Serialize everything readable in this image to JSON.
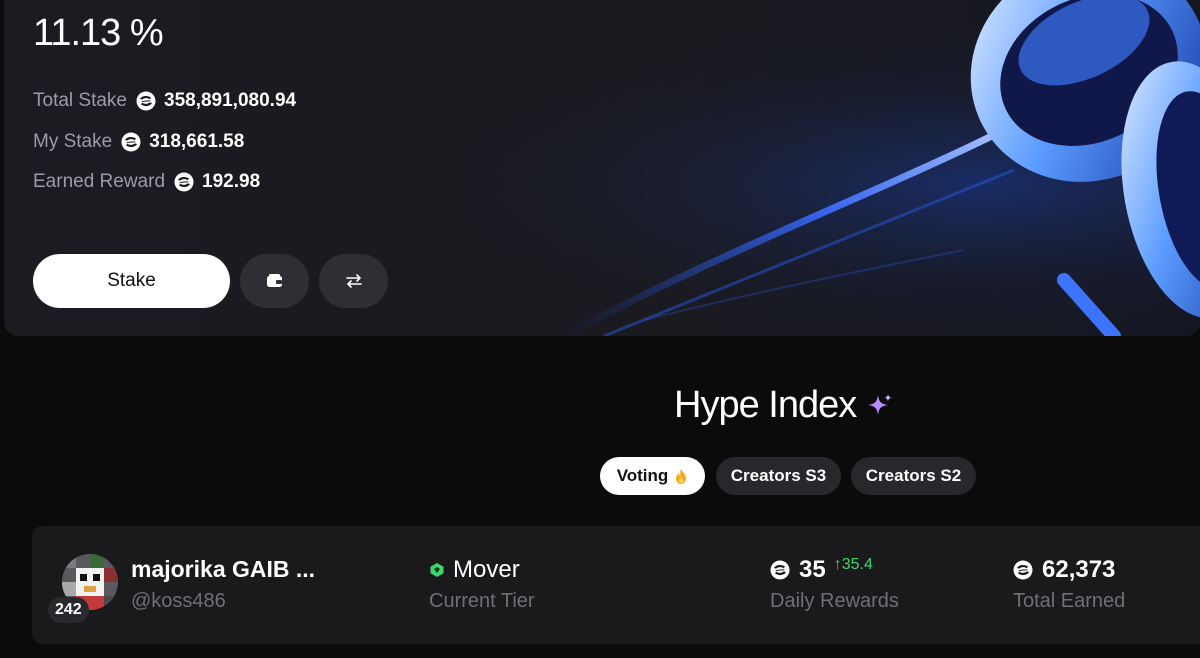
{
  "stake": {
    "apy": "11.13 %",
    "total_stake_label": "Total Stake",
    "total_stake_value": "358,891,080.94",
    "my_stake_label": "My Stake",
    "my_stake_value": "318,661.58",
    "earned_reward_label": "Earned Reward",
    "earned_reward_value": "192.98",
    "stake_button": "Stake",
    "coin_icon": "token-coin-icon",
    "wallet_icon": "wallet-icon",
    "swap_icon": "swap-arrows-icon"
  },
  "hype_index": {
    "title": "Hype Index",
    "title_icon": "sparkle-icon",
    "tabs": [
      {
        "label": "Voting",
        "icon": "fire-icon",
        "active": true
      },
      {
        "label": "Creators S3",
        "active": false
      },
      {
        "label": "Creators S2",
        "active": false
      }
    ]
  },
  "creator_row": {
    "rank": "242",
    "name": "majorika GAIB ...",
    "handle": "@koss486",
    "tier": "Mover",
    "tier_icon": "tier-gem-icon",
    "tier_label": "Current Tier",
    "daily_rewards": "35",
    "daily_delta": "↑35.4",
    "daily_rewards_label": "Daily Rewards",
    "total_earned": "62,373",
    "total_earned_label": "Total Earned"
  },
  "colors": {
    "accent_blue": "#2f6bff",
    "delta_green": "#3ed66b",
    "tier_green": "#3ed66b",
    "sparkle_purple": "#b58cff",
    "fire_orange": "#f5a623"
  }
}
